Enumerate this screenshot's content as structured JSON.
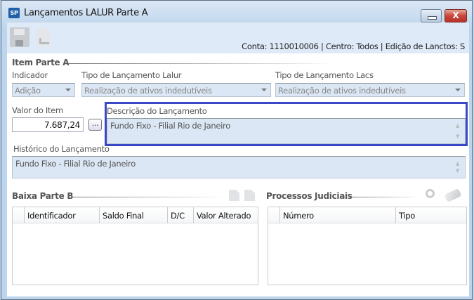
{
  "window": {
    "title": "Lançamentos LALUR Parte A",
    "app_icon_text": "SP",
    "minimize_label": "—",
    "close_label": "X"
  },
  "toolbar": {
    "status": "Conta: 1110010006 | Centro: Todos | Edição de Lanctos: S"
  },
  "item_parte_a": {
    "title": "Item Parte A",
    "indicador": {
      "label": "Indicador",
      "value": "Adição"
    },
    "tipo_lalur": {
      "label": "Tipo de Lançamento Lalur",
      "value": "Realização de ativos indedutíveis"
    },
    "tipo_lacs": {
      "label": "Tipo de Lançamento Lacs",
      "value": "Realização de ativos indedutíveis"
    },
    "valor": {
      "label": "Valor do Item",
      "value": "7.687,24",
      "button": "..."
    },
    "descricao": {
      "label": "Descrição do Lançamento",
      "value": "Fundo Fixo - Filial Rio de Janeiro"
    },
    "historico": {
      "label": "Histórico do Lançamento",
      "value": "Fundo Fixo - Filial Rio de Janeiro"
    }
  },
  "baixa_parte_b": {
    "title": "Baixa Parte B",
    "columns": [
      "Identificador",
      "Saldo Final",
      "D/C",
      "Valor Alterado"
    ],
    "rows": []
  },
  "processos": {
    "title": "Processos Judiciais",
    "columns": [
      "Número",
      "Tipo"
    ],
    "rows": []
  },
  "colors": {
    "highlight": "#3b48c6",
    "field_bg": "#dbe7f5",
    "toolbar_bg": "#dfeaf8"
  }
}
